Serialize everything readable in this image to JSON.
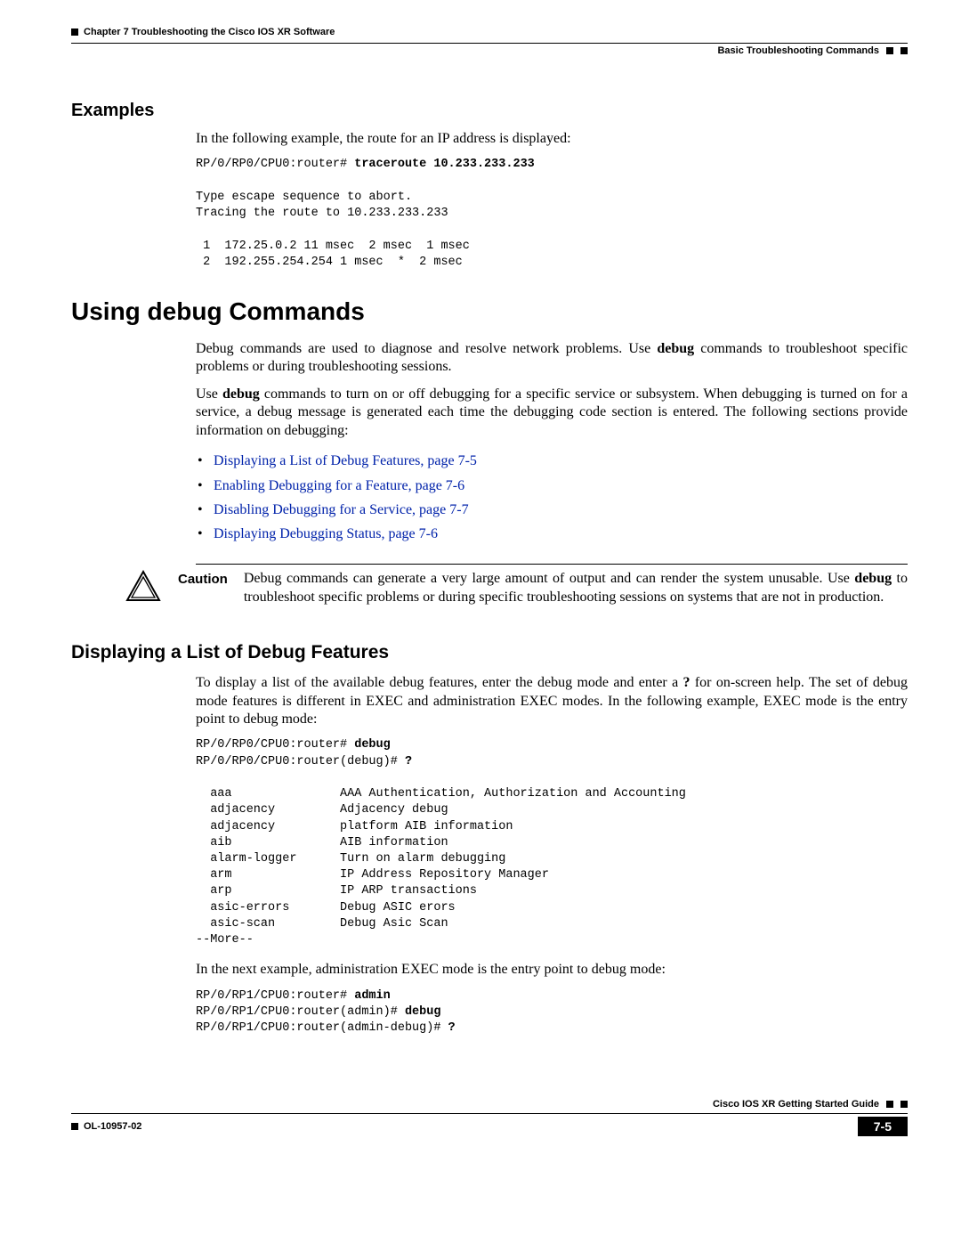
{
  "header": {
    "chapter": "Chapter 7    Troubleshooting the Cisco IOS XR Software",
    "section": "Basic Troubleshooting Commands"
  },
  "examples": {
    "heading": "Examples",
    "intro": "In the following example, the route for an IP address is displayed:",
    "code_prompt": "RP/0/RP0/CPU0:router# ",
    "code_cmd": "traceroute 10.233.233.233",
    "code_rest": "\n\nType escape sequence to abort.\nTracing the route to 10.233.233.233\n\n 1  172.25.0.2 11 msec  2 msec  1 msec\n 2  192.255.254.254 1 msec  *  2 msec"
  },
  "using_debug": {
    "heading": "Using debug Commands",
    "para1a": "Debug commands are used to diagnose and resolve network problems. Use ",
    "para1b": "debug",
    "para1c": " commands to troubleshoot specific problems or during troubleshooting sessions.",
    "para2a": "Use ",
    "para2b": "debug",
    "para2c": " commands to turn on or off debugging for a specific service or subsystem. When debugging is turned on for a service, a debug message is generated each time the debugging code section is entered. The following sections provide information on debugging:",
    "links": [
      "Displaying a List of Debug Features, page 7-5",
      "Enabling Debugging for a Feature, page 7-6",
      "Disabling Debugging for a Service, page 7-7",
      "Displaying Debugging Status, page 7-6"
    ]
  },
  "caution": {
    "label": "Caution",
    "text_a": "Debug commands can generate a very large amount of output and can render the system unusable. Use ",
    "text_b": "debug",
    "text_c": " to troubleshoot specific problems or during specific troubleshooting sessions on systems that are not in production."
  },
  "displaying": {
    "heading": "Displaying a List of Debug Features",
    "para1a": "To display a list of the available debug features, enter the debug mode and enter a ",
    "para1b": "?",
    "para1c": " for on-screen help. The set of debug mode features is different in EXEC and administration EXEC modes. In the following example, EXEC mode is the entry point to debug mode:",
    "code1_l1p": "RP/0/RP0/CPU0:router# ",
    "code1_l1c": "debug",
    "code1_l2p": "RP/0/RP0/CPU0:router(debug)# ",
    "code1_l2c": "?",
    "code1_rest": "\n\n  aaa               AAA Authentication, Authorization and Accounting\n  adjacency         Adjacency debug\n  adjacency         platform AIB information\n  aib               AIB information\n  alarm-logger      Turn on alarm debugging\n  arm               IP Address Repository Manager\n  arp               IP ARP transactions\n  asic-errors       Debug ASIC erors\n  asic-scan         Debug Asic Scan\n--More--",
    "para2": "In the next example, administration EXEC mode is the entry point to debug mode:",
    "code2_l1p": "RP/0/RP1/CPU0:router# ",
    "code2_l1c": "admin",
    "code2_l2p": "RP/0/RP1/CPU0:router(admin)# ",
    "code2_l2c": "debug",
    "code2_l3p": "RP/0/RP1/CPU0:router(admin-debug)# ",
    "code2_l3c": "?"
  },
  "footer": {
    "guide": "Cisco IOS XR Getting Started Guide",
    "docnum": "OL-10957-02",
    "pagenum": "7-5"
  }
}
